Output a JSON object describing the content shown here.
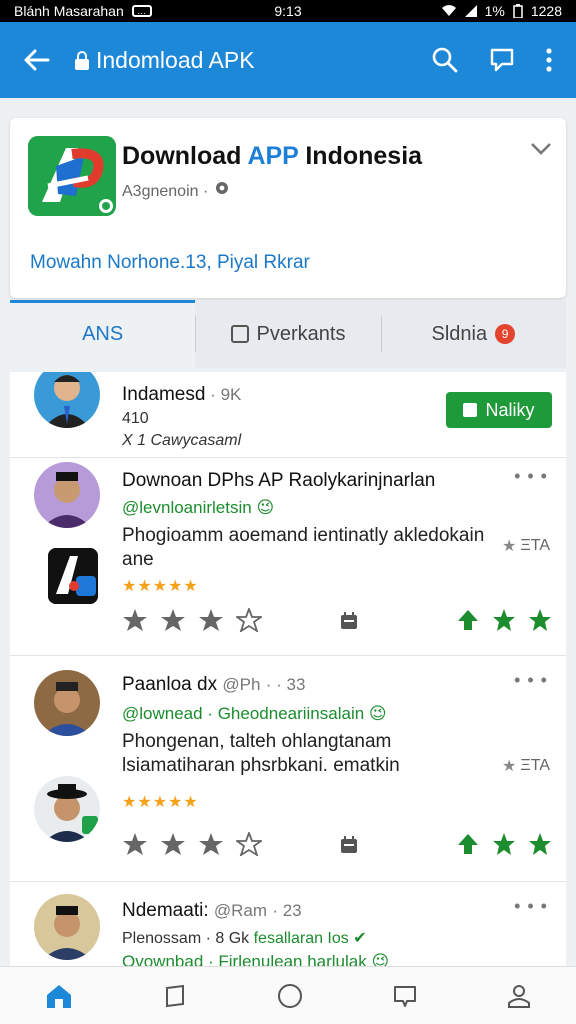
{
  "status_bar": {
    "left_text": "Blánh Masarahan",
    "time": "9:13",
    "battery": "1%",
    "clock_right": "1228"
  },
  "app_bar": {
    "title": "Indomload APK",
    "back_icon": "arrow-left-icon",
    "lock_icon": "lock-icon",
    "actions": [
      "search-icon",
      "chat-bubble-icon",
      "more-vert-icon"
    ]
  },
  "app_card": {
    "name_prefix": "Download ",
    "name_highlight": "APP",
    "name_suffix": " Indonesia",
    "developer": "A3gnenoin",
    "link_text": "Mowahn Norhone.13, Piyal Rkrar",
    "expand_icon": "chevron-down-icon"
  },
  "tabs": [
    {
      "label": "ANS",
      "active": true
    },
    {
      "label": "Pverkants",
      "active": false
    },
    {
      "label": "Sldnia",
      "active": false,
      "badge": "9"
    }
  ],
  "posts": [
    {
      "name": "Indamesd",
      "sep": " · ",
      "count": "9K",
      "meta1": "410",
      "meta2": "X 1 Cawycasaml",
      "follow_label": "Naliky"
    },
    {
      "name": "Downoan DPhs AP Raolykarinjnarlan",
      "handle": "@levnloanirletsin",
      "body": "Phogioamm aoemand ientinatly akledokain ane",
      "gold_stars": "★★★★★",
      "rating_text": "ΞΤΑ",
      "ratings": {
        "stars_filled": 3,
        "stars_total": 4,
        "upvotes": 3
      }
    },
    {
      "name": "Paanloa dx",
      "handle_muted": "@Ph",
      "time": "33",
      "tag": "@lownead · Gheodneariinsalain",
      "body": "Phongenan, talteh ohlangtanam lsiamatiharan phsrbkani. ematkin",
      "gold_stars": "★★★★★",
      "rating_text": "ΞΤΑ",
      "ratings": {
        "stars_filled": 3,
        "stars_total": 4,
        "upvotes": 3
      }
    },
    {
      "name": "Ndemaati:",
      "handle_muted": "@Ram",
      "time": "23",
      "meta": "Plenossam · 8 Gk",
      "meta_green": "fesallaran Ios",
      "tag": "Ovownbad · Firlenulean harlulak"
    }
  ],
  "bottom_nav": [
    "home-icon",
    "bookmark-icon",
    "circle-icon",
    "chat-icon",
    "profile-icon"
  ],
  "colors": {
    "brand": "#1e88d8",
    "green": "#1f9a3a",
    "gold": "#f4a21a"
  }
}
